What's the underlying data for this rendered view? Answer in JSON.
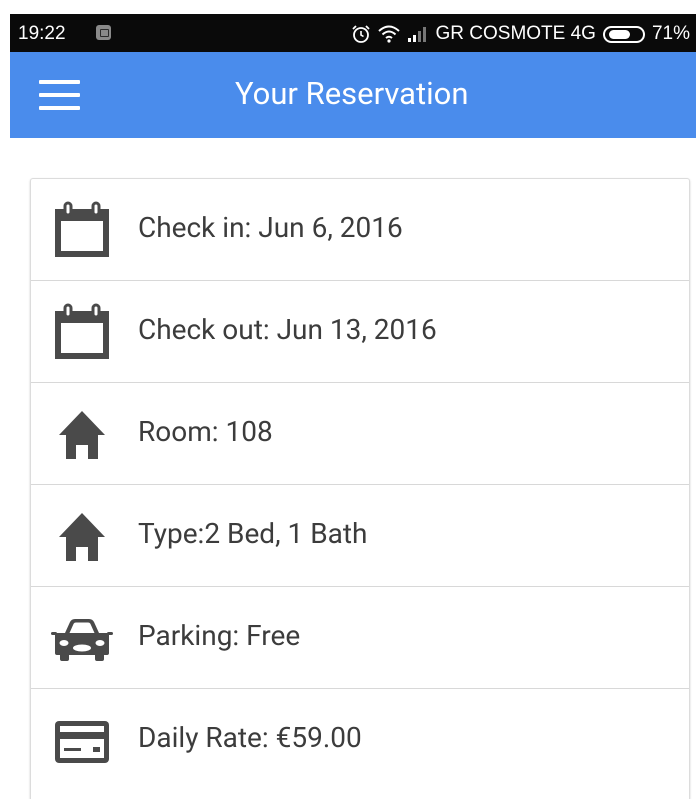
{
  "status_bar": {
    "time": "19:22",
    "carrier": "GR COSMOTE 4G",
    "battery_percent": "71%",
    "battery_level": 0.71
  },
  "app_bar": {
    "title": "Your Reservation"
  },
  "reservation": {
    "items": [
      {
        "icon": "calendar-icon",
        "label": "Check in: Jun 6, 2016"
      },
      {
        "icon": "calendar-icon",
        "label": "Check out: Jun 13, 2016"
      },
      {
        "icon": "home-icon",
        "label": "Room: 108"
      },
      {
        "icon": "home-icon",
        "label": "Type:2 Bed, 1 Bath"
      },
      {
        "icon": "car-icon",
        "label": "Parking: Free"
      },
      {
        "icon": "credit-card-icon",
        "label": "Daily Rate: €59.00"
      }
    ]
  },
  "colors": {
    "app_bar": "#4a8cec",
    "status_bar": "#0a0a0a",
    "icon": "#4a4a4a",
    "text": "#3c3c3c"
  }
}
